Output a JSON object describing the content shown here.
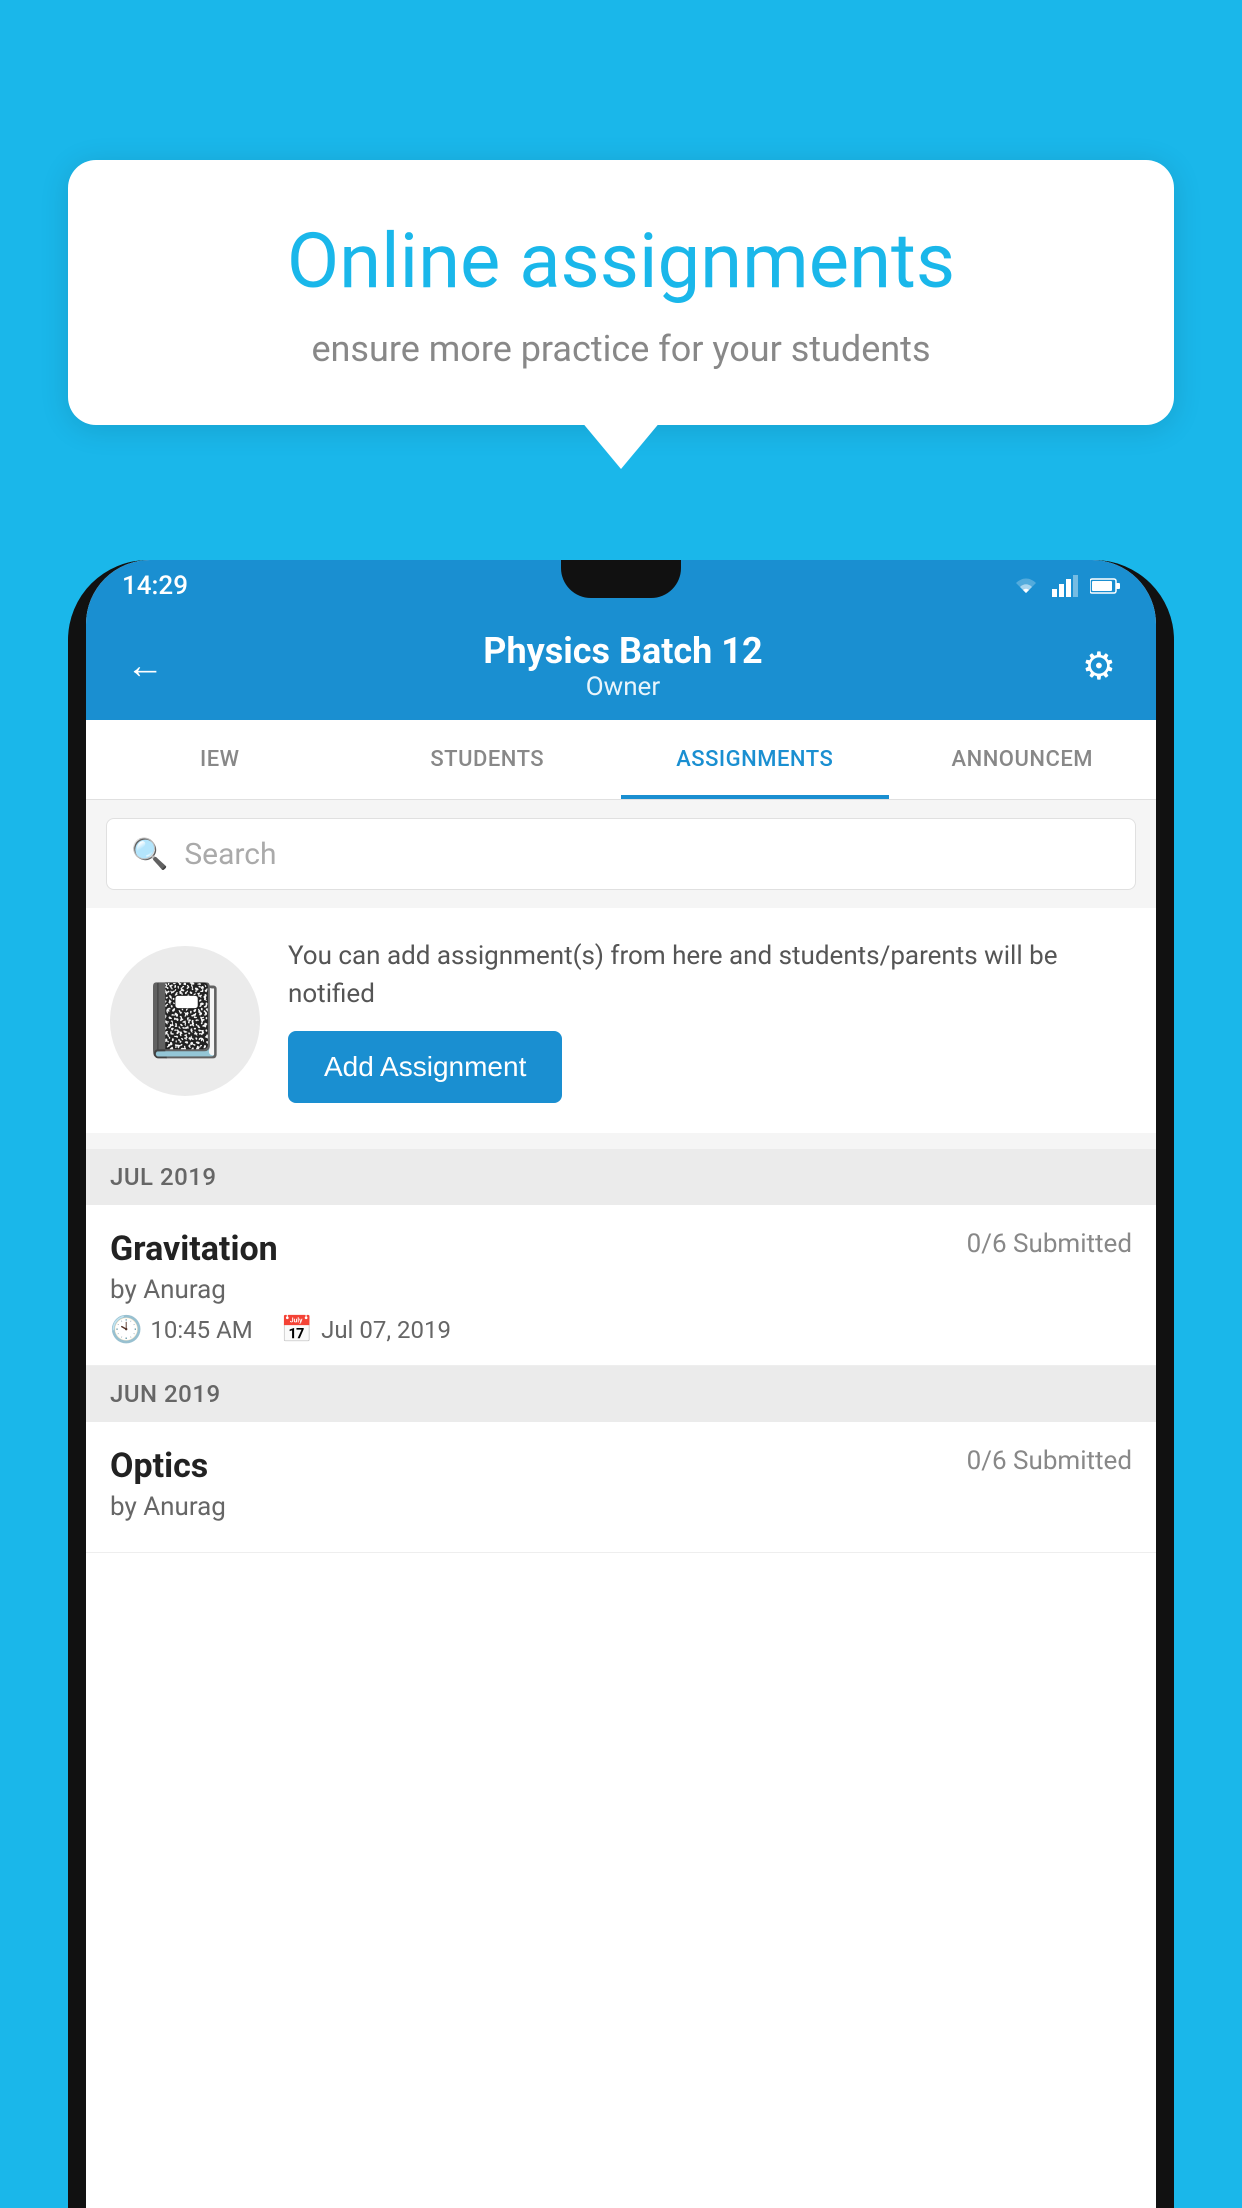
{
  "background_color": "#1ab7ea",
  "promo": {
    "title": "Online assignments",
    "subtitle": "ensure more practice for your students"
  },
  "phone": {
    "status_bar": {
      "time": "14:29",
      "icons": [
        "wifi",
        "signal",
        "battery"
      ]
    },
    "header": {
      "title": "Physics Batch 12",
      "subtitle": "Owner",
      "back_label": "←",
      "settings_label": "⚙"
    },
    "tabs": [
      {
        "label": "IEW",
        "active": false
      },
      {
        "label": "STUDENTS",
        "active": false
      },
      {
        "label": "ASSIGNMENTS",
        "active": true
      },
      {
        "label": "ANNOUNCEM",
        "active": false
      }
    ],
    "search": {
      "placeholder": "Search"
    },
    "add_assignment_section": {
      "info_text": "You can add assignment(s) from here and students/parents will be notified",
      "button_label": "Add Assignment"
    },
    "sections": [
      {
        "label": "JUL 2019",
        "items": [
          {
            "name": "Gravitation",
            "submitted": "0/6 Submitted",
            "by": "by Anurag",
            "time": "10:45 AM",
            "date": "Jul 07, 2019"
          }
        ]
      },
      {
        "label": "JUN 2019",
        "items": [
          {
            "name": "Optics",
            "submitted": "0/6 Submitted",
            "by": "by Anurag",
            "time": "",
            "date": ""
          }
        ]
      }
    ]
  }
}
